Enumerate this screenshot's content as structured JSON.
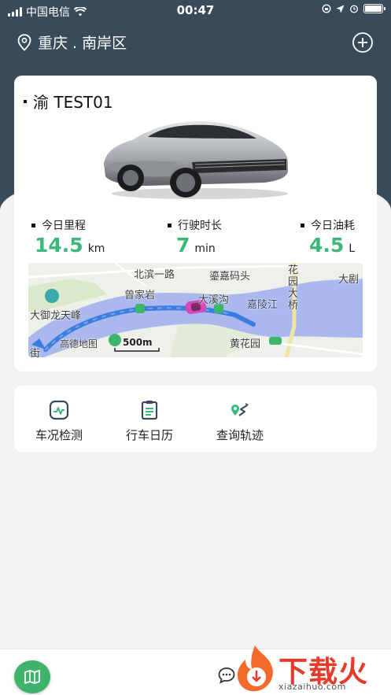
{
  "status_bar": {
    "carrier": "中国电信",
    "time": "00:47"
  },
  "header": {
    "location": "重庆 . 南岸区",
    "icons": [
      "location-pin-icon",
      "add-circle-icon"
    ]
  },
  "vehicle": {
    "plate": "渝 TEST01",
    "stats": [
      {
        "label": "今日里程",
        "value": "14.5",
        "unit": "km"
      },
      {
        "label": "行驶时长",
        "value": "7",
        "unit": "min"
      },
      {
        "label": "今日油耗",
        "value": "4.5",
        "unit": "L"
      }
    ],
    "map": {
      "labels": [
        "北滨一路",
        "鎏嘉码头",
        "大剧",
        "曾家岩",
        "大溪沟",
        "嘉陵江",
        "花园大桥",
        "大御龙天峰",
        "高德地图",
        "500m",
        "黄花园",
        "街"
      ]
    }
  },
  "actions": [
    {
      "label": "车况检测",
      "icon": "vehicle-check-icon"
    },
    {
      "label": "行车日历",
      "icon": "calendar-clipboard-icon"
    },
    {
      "label": "查询轨迹",
      "icon": "track-route-icon"
    }
  ],
  "bottom": {
    "icons": [
      "map-icon",
      "chat-bubble-icon"
    ]
  },
  "watermark": {
    "text": "下载火",
    "url": "xiazaihuo.com"
  },
  "colors": {
    "header": "#394a5a",
    "accent_green": "#3cb878",
    "background": "#f2f2f2",
    "water": "#a9b8ee",
    "route": "#3b7ddd",
    "watermark_red": "#e53a2c"
  }
}
